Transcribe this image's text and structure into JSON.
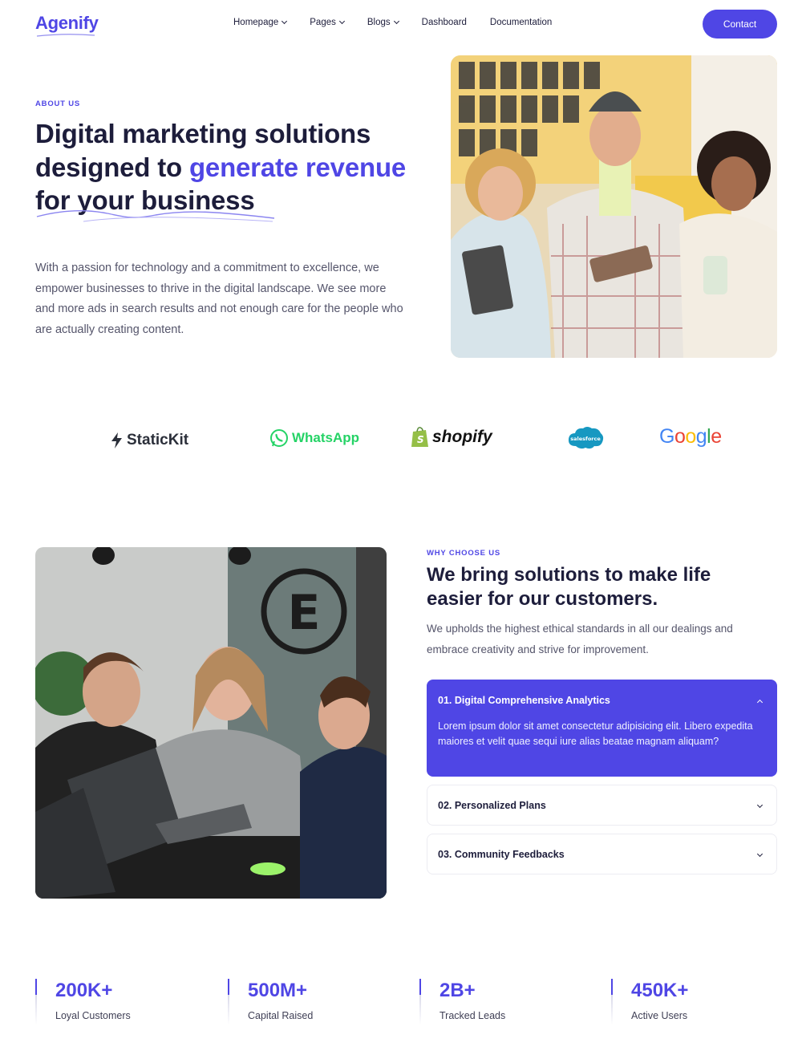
{
  "nav": {
    "logo": "Agenify",
    "items": [
      {
        "label": "Homepage",
        "dropdown": true
      },
      {
        "label": "Pages",
        "dropdown": true
      },
      {
        "label": "Blogs",
        "dropdown": true
      },
      {
        "label": "Dashboard",
        "dropdown": false
      },
      {
        "label": "Documentation",
        "dropdown": false
      }
    ],
    "contact_label": "Contact"
  },
  "hero": {
    "eyebrow": "ABOUT US",
    "title_part1": "Digital marketing solutions designed to",
    "title_highlight": "generate revenue",
    "title_part2": "for your business",
    "description": "With a passion for technology and a commitment to excellence, we empower businesses to thrive in the digital landscape. We see more and more ads in search results and not enough care for the people who are actually creating content."
  },
  "logos": [
    {
      "name": "StaticKit",
      "icon": "statickit-bolt-icon"
    },
    {
      "name": "WhatsApp",
      "icon": "whatsapp-icon"
    },
    {
      "name": "shopify",
      "icon": "shopify-bag-icon"
    },
    {
      "name": "salesforce",
      "icon": "salesforce-cloud-icon"
    },
    {
      "name": "Google",
      "icon": "google-wordmark"
    }
  ],
  "why": {
    "eyebrow": "WHY CHOOSE US",
    "title": "We bring solutions to make life easier for our customers.",
    "description": "We upholds the highest ethical standards in all our dealings and embrace creativity and strive for improvement.",
    "accordion": [
      {
        "title": "01. Digital Comprehensive Analytics",
        "body": "Lorem ipsum dolor sit amet consectetur adipisicing elit. Libero expedita maiores et velit quae sequi iure alias beatae magnam aliquam?",
        "open": true
      },
      {
        "title": "02. Personalized Plans",
        "body": "",
        "open": false
      },
      {
        "title": "03. Community Feedbacks",
        "body": "",
        "open": false
      }
    ]
  },
  "stats": [
    {
      "value": "200K+",
      "label": "Loyal Customers"
    },
    {
      "value": "500M+",
      "label": "Capital Raised"
    },
    {
      "value": "2B+",
      "label": "Tracked Leads"
    },
    {
      "value": "450K+",
      "label": "Active Users"
    }
  ],
  "colors": {
    "accent": "#4f46e5",
    "text": "#1d1d3b",
    "muted": "#55556b"
  }
}
